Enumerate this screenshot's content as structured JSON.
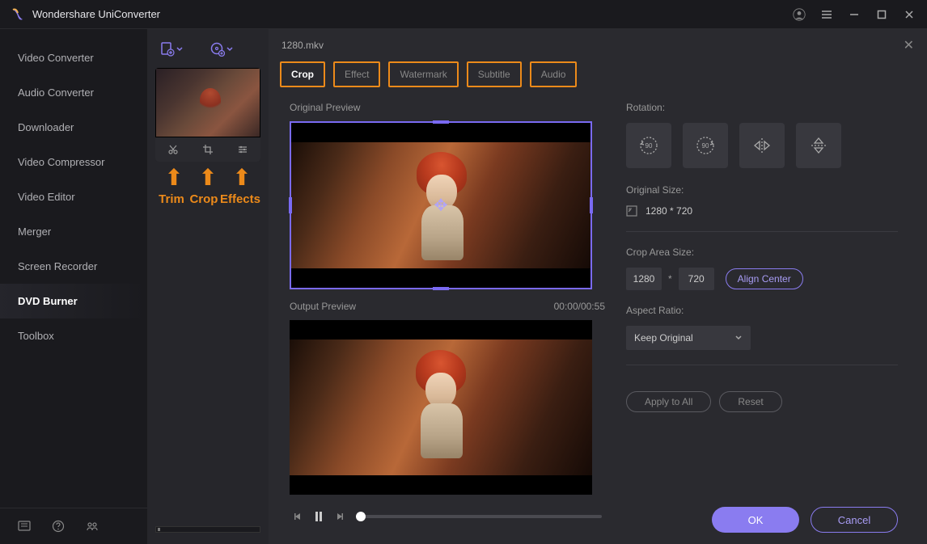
{
  "app": {
    "title": "Wondershare UniConverter"
  },
  "sidebar": {
    "items": [
      {
        "label": "Video Converter"
      },
      {
        "label": "Audio Converter"
      },
      {
        "label": "Downloader"
      },
      {
        "label": "Video Compressor"
      },
      {
        "label": "Video Editor"
      },
      {
        "label": "Merger"
      },
      {
        "label": "Screen Recorder"
      },
      {
        "label": "DVD Burner"
      },
      {
        "label": "Toolbox"
      }
    ],
    "active_index": 7
  },
  "thumb_tools": {
    "labels": [
      "Trim",
      "Crop",
      "Effects"
    ]
  },
  "editor": {
    "filename": "1280.mkv",
    "tabs": [
      {
        "label": "Crop"
      },
      {
        "label": "Effect"
      },
      {
        "label": "Watermark"
      },
      {
        "label": "Subtitle"
      },
      {
        "label": "Audio"
      }
    ],
    "active_tab": 0,
    "original_preview_label": "Original Preview",
    "output_preview_label": "Output Preview",
    "time": "00:00/00:55"
  },
  "settings": {
    "rotation_label": "Rotation:",
    "original_size_label": "Original Size:",
    "original_size_value": "1280 * 720",
    "crop_area_label": "Crop Area Size:",
    "crop_w": "1280",
    "crop_h": "720",
    "align_center": "Align Center",
    "aspect_ratio_label": "Aspect Ratio:",
    "aspect_ratio_value": "Keep Original",
    "apply_all": "Apply to All",
    "reset": "Reset",
    "ok": "OK",
    "cancel": "Cancel"
  }
}
